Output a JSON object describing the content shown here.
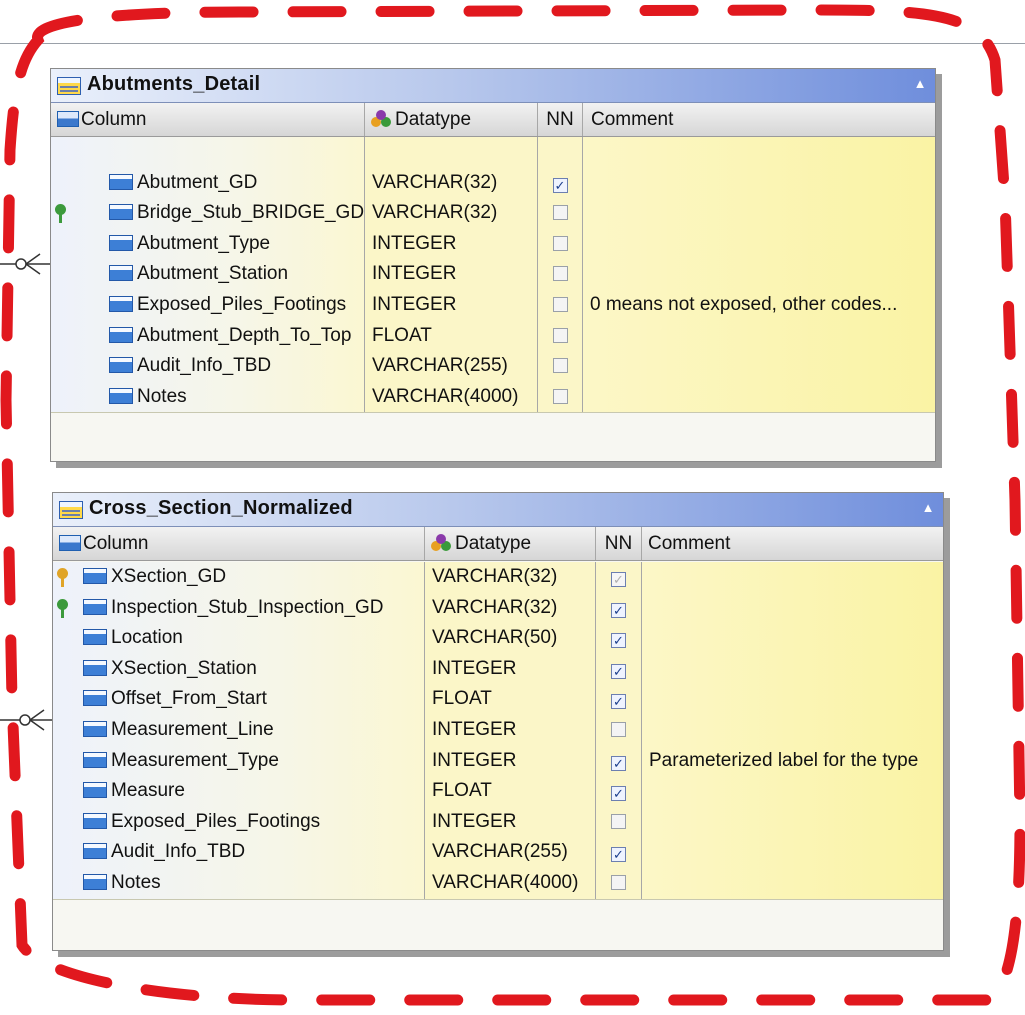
{
  "colors": {
    "dash_border": "#e1181e",
    "title_gradient_end": "#6f8edc",
    "row_fill": "#fbf6c8"
  },
  "headers": {
    "column": "Column",
    "datatype": "Datatype",
    "nn": "NN",
    "comment": "Comment"
  },
  "entities": [
    {
      "name": "Abutments_Detail",
      "rows": [
        {
          "key": "",
          "column": "",
          "datatype": "",
          "nn": "",
          "comment": ""
        },
        {
          "key": "",
          "column": "Abutment_GD",
          "datatype": "VARCHAR(32)",
          "nn": "checked",
          "comment": ""
        },
        {
          "key": "foreign",
          "column": "Bridge_Stub_BRIDGE_GD",
          "datatype": "VARCHAR(32)",
          "nn": "unchecked",
          "comment": ""
        },
        {
          "key": "",
          "column": "Abutment_Type",
          "datatype": "INTEGER",
          "nn": "unchecked",
          "comment": ""
        },
        {
          "key": "",
          "column": "Abutment_Station",
          "datatype": "INTEGER",
          "nn": "unchecked",
          "comment": ""
        },
        {
          "key": "",
          "column": "Exposed_Piles_Footings",
          "datatype": "INTEGER",
          "nn": "unchecked",
          "comment": "0 means not exposed, other codes..."
        },
        {
          "key": "",
          "column": "Abutment_Depth_To_Top",
          "datatype": "FLOAT",
          "nn": "unchecked",
          "comment": ""
        },
        {
          "key": "",
          "column": "Audit_Info_TBD",
          "datatype": "VARCHAR(255)",
          "nn": "unchecked",
          "comment": ""
        },
        {
          "key": "",
          "column": "Notes",
          "datatype": "VARCHAR(4000)",
          "nn": "unchecked",
          "comment": ""
        }
      ]
    },
    {
      "name": "Cross_Section_Normalized",
      "rows": [
        {
          "key": "primary",
          "column": "XSection_GD",
          "datatype": "VARCHAR(32)",
          "nn": "checked-disabled",
          "comment": ""
        },
        {
          "key": "foreign",
          "column": "Inspection_Stub_Inspection_GD",
          "datatype": "VARCHAR(32)",
          "nn": "checked",
          "comment": ""
        },
        {
          "key": "",
          "column": "Location",
          "datatype": "VARCHAR(50)",
          "nn": "checked",
          "comment": ""
        },
        {
          "key": "",
          "column": "XSection_Station",
          "datatype": "INTEGER",
          "nn": "checked",
          "comment": ""
        },
        {
          "key": "",
          "column": "Offset_From_Start",
          "datatype": "FLOAT",
          "nn": "checked",
          "comment": ""
        },
        {
          "key": "",
          "column": "Measurement_Line",
          "datatype": "INTEGER",
          "nn": "unchecked",
          "comment": ""
        },
        {
          "key": "",
          "column": "Measurement_Type",
          "datatype": "INTEGER",
          "nn": "checked",
          "comment": "Parameterized label for the type"
        },
        {
          "key": "",
          "column": "Measure",
          "datatype": "FLOAT",
          "nn": "checked",
          "comment": ""
        },
        {
          "key": "",
          "column": "Exposed_Piles_Footings",
          "datatype": "INTEGER",
          "nn": "unchecked",
          "comment": ""
        },
        {
          "key": "",
          "column": "Audit_Info_TBD",
          "datatype": "VARCHAR(255)",
          "nn": "checked",
          "comment": ""
        },
        {
          "key": "",
          "column": "Notes",
          "datatype": "VARCHAR(4000)",
          "nn": "unchecked",
          "comment": ""
        }
      ]
    }
  ]
}
